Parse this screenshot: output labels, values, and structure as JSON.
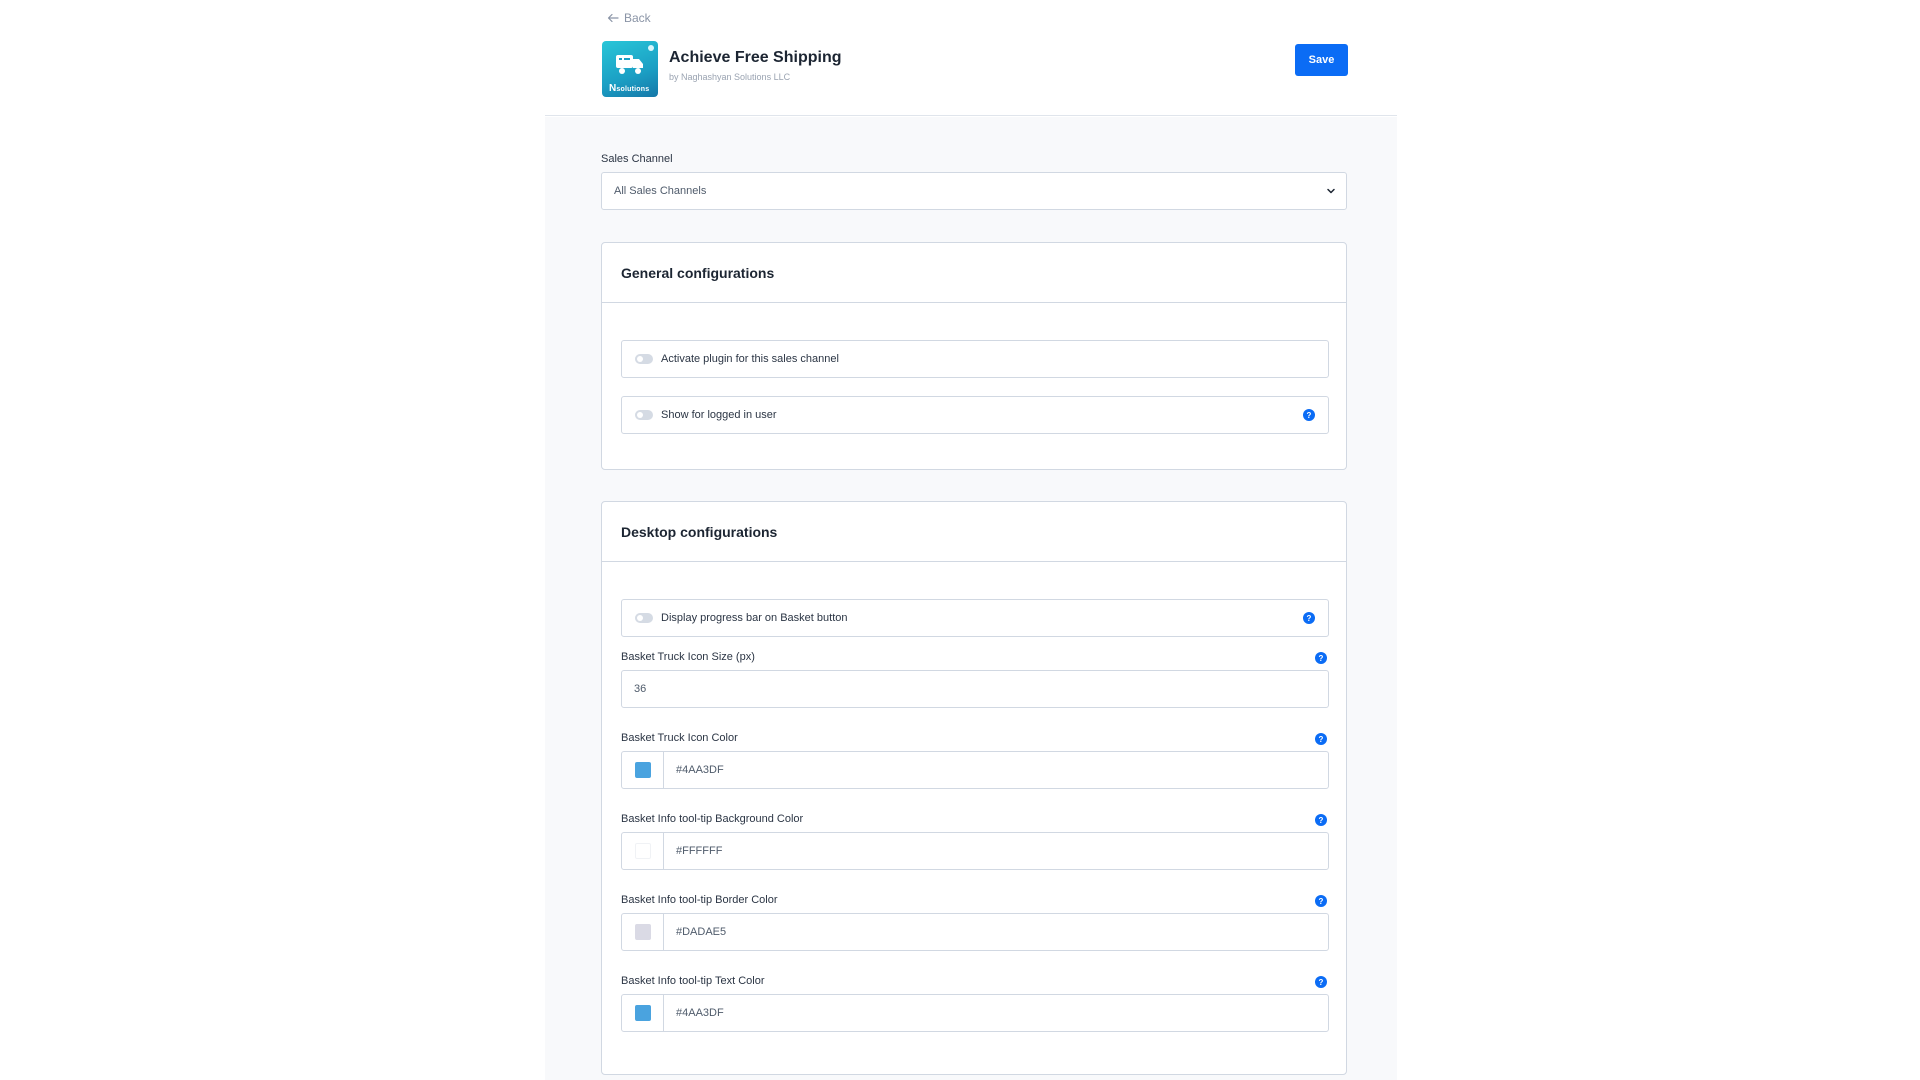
{
  "header": {
    "back_label": "Back",
    "app_title": "Achieve Free Shipping",
    "app_vendor": "by Naghashyan Solutions LLC",
    "icon_brand_letter": "N",
    "icon_brand_text": "solutions",
    "save_label": "Save"
  },
  "sales_channel": {
    "label": "Sales Channel",
    "selected": "All Sales Channels"
  },
  "general": {
    "title": "General configurations",
    "activate_label": "Activate plugin for this sales channel",
    "logged_in_label": "Show for logged in user"
  },
  "desktop": {
    "title": "Desktop configurations",
    "progress_label": "Display progress bar on Basket button",
    "icon_size_label": "Basket Truck Icon Size (px)",
    "icon_size_value": "36",
    "colors": [
      {
        "label": "Basket Truck Icon Color",
        "value": "#4AA3DF",
        "swatch": "#4AA3DF"
      },
      {
        "label": "Basket Info tool-tip Background Color",
        "value": "#FFFFFF",
        "swatch": "#FFFFFF"
      },
      {
        "label": "Basket Info tool-tip Border Color",
        "value": "#DADAE5",
        "swatch": "#DADAE5"
      },
      {
        "label": "Basket Info tool-tip Text Color",
        "value": "#4AA3DF",
        "swatch": "#4AA3DF"
      }
    ]
  },
  "help_glyph": "?",
  "theme": {
    "primary": "#0B6CF5",
    "border": "#D1D8E2",
    "page_bg": "#F8F9FB"
  }
}
